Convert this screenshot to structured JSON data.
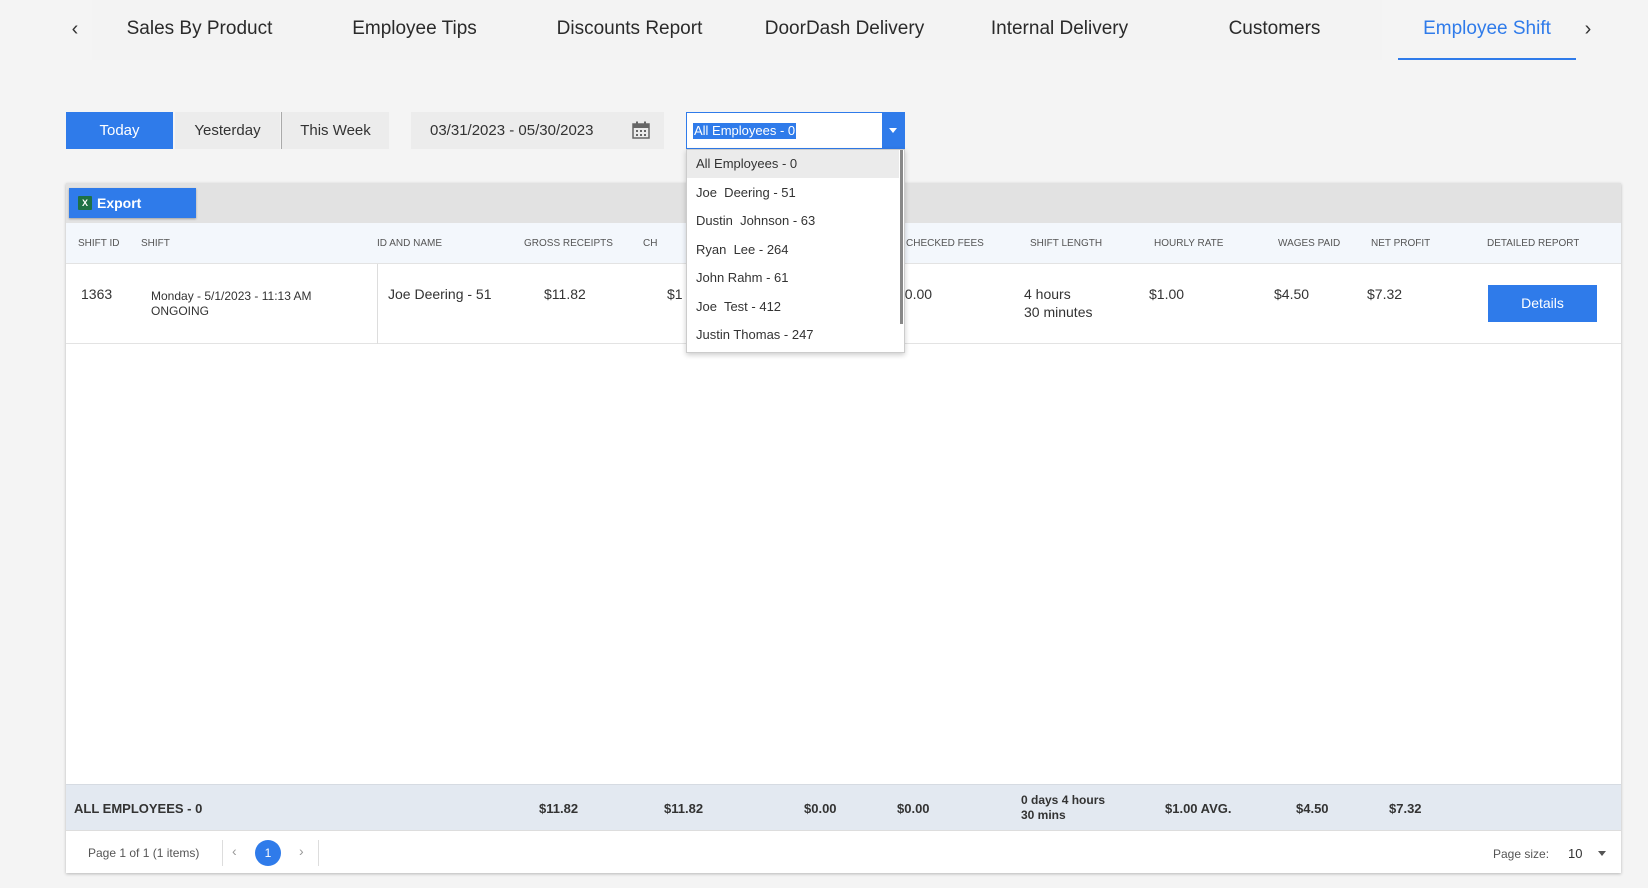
{
  "tabs": {
    "items": [
      {
        "label": "Sales By Product"
      },
      {
        "label": "Employee Tips"
      },
      {
        "label": "Discounts Report"
      },
      {
        "label": "DoorDash Delivery"
      },
      {
        "label": "Internal Delivery"
      },
      {
        "label": "Customers"
      },
      {
        "label": "Employee Shift"
      }
    ],
    "active": "Employee Shift",
    "prev_icon": "chevron-left-icon",
    "next_icon": "chevron-right-icon"
  },
  "filters": {
    "periods": [
      "Today",
      "Yesterday",
      "This Week"
    ],
    "active_period": "Today",
    "date_range": "03/31/2023 - 05/30/2023",
    "employee_selected": "All Employees - 0",
    "employee_options": [
      "All Employees - 0",
      "Joe  Deering - 51",
      "Dustin  Johnson - 63",
      "Ryan  Lee - 264",
      "John Rahm - 61",
      "Joe  Test - 412",
      "Justin Thomas - 247"
    ]
  },
  "toolbar": {
    "export_label": "Export",
    "export_icon": "excel-icon"
  },
  "table": {
    "columns": [
      "Shift ID",
      "Shift",
      "ID and Name",
      "Gross Receipts",
      "Ch",
      "Checked Fees",
      "Shift Length",
      "Hourly Rate",
      "Wages Paid",
      "Net Profit",
      "Detailed Report"
    ],
    "rows": [
      {
        "shift_id": "1363",
        "shift_date": "Monday - 5/1/2023 - 11:13 AM",
        "shift_status": "ONGOING",
        "id_name": "Joe Deering - 51",
        "gross_receipts": "$11.82",
        "ch_partial": "$1",
        "checked_fees_partial": "$0.00",
        "shift_length_1": "4 hours",
        "shift_length_2": "30 minutes",
        "hourly_rate": "$1.00",
        "wages_paid": "$4.50",
        "net_profit": "$7.32",
        "details_label": "Details"
      }
    ],
    "footer": {
      "label": "ALL EMPLOYEES - 0",
      "gross_receipts": "$11.82",
      "col_ch": "$11.82",
      "col_a": "$0.00",
      "checked_fees": "$0.00",
      "shift_length_1": "0 days 4 hours",
      "shift_length_2": "30 mins",
      "hourly_rate": "$1.00 AVG.",
      "wages_paid": "$4.50",
      "net_profit": "$7.32"
    }
  },
  "pager": {
    "info": "Page 1 of 1 (1 items)",
    "current_page": "1",
    "page_size_label": "Page size:",
    "page_size": "10"
  },
  "colors": {
    "accent": "#2f7bea",
    "excel_green": "#1e7145"
  }
}
